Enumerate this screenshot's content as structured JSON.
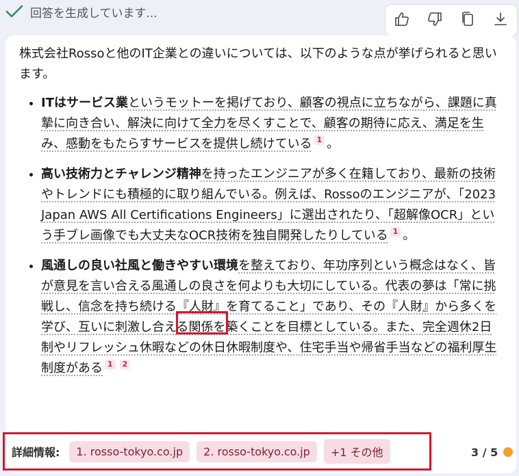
{
  "status": {
    "text": "回答を生成しています..."
  },
  "toolbar": {
    "icons": [
      "thumbs-up-icon",
      "thumbs-down-icon",
      "copy-icon",
      "download-icon"
    ]
  },
  "message": {
    "intro": "株式会社Rossoと他のIT企業との違いについては、以下のような点が挙げられると思います。",
    "bullets": [
      {
        "bold": "ITはサービス業",
        "text": "というモットーを掲げており、顧客の視点に立ちながら、課題に真摯に向き合い、解決に向けて全力を尽くすことで、顧客の期待に応え、満足を生み、感動をもたらすサービスを提供し続けている",
        "cites": [
          "1"
        ],
        "end": "。"
      },
      {
        "bold": "高い技術力とチャレンジ精神",
        "text": "を持ったエンジニアが多く在籍しており、最新の技術やトレンドにも積極的に取り組んでいる。例えば、Rossoのエンジニアが、「2023 Japan AWS All Certifications Engineers」に選出されたり、「超解像OCR」という手ブレ画像でも大丈夫なOCR技術を独自開発したりしている",
        "cites": [
          "1"
        ],
        "end": "。"
      },
      {
        "bold": "風通しの良い社風と働きやすい環境",
        "text": "を整えており、年功序列という概念はなく、皆が意見を言い合える風通しの良さを何よりも大切にしている。代表の夢は「常に挑戦し、信念を持ち続ける『人財』を育てること」であり、その『人財』から多くを学び、互いに刺激し合える関係を築くことを目標としている。また、完全週休2日制やリフレッシュ休暇などの休日休暇制度や、住宅手当や帰省手当などの福利厚生制度がある",
        "cites": [
          "1",
          "2"
        ],
        "end": ""
      }
    ]
  },
  "footer": {
    "label": "詳細情報:",
    "sources": [
      "1. rosso-tokyo.co.jp",
      "2. rosso-tokyo.co.jp",
      "+1 その他"
    ]
  },
  "pager": {
    "text": "3 / 5",
    "dot_color": "#f2a02a"
  },
  "colors": {
    "accent": "#d8152a",
    "chip_bg": "#f8dce4",
    "check": "#2e8b57"
  }
}
